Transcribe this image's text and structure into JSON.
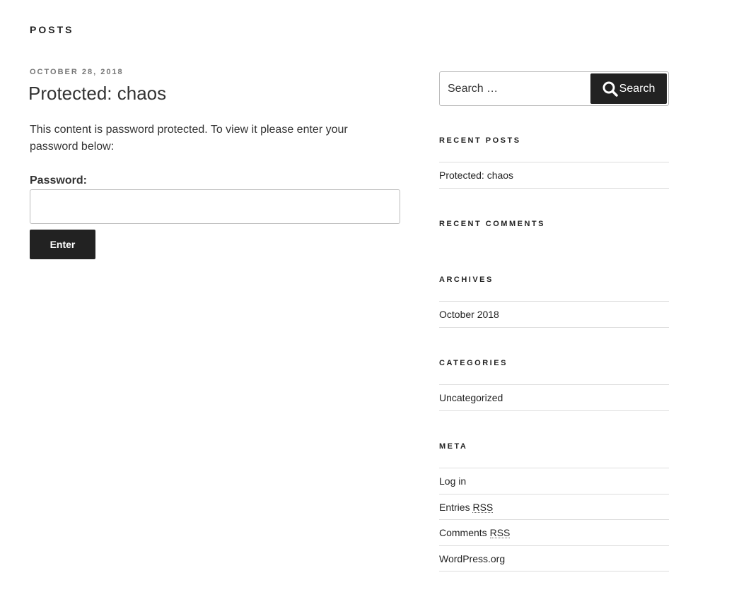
{
  "page": {
    "heading": "POSTS"
  },
  "post": {
    "date": "OCTOBER 28, 2018",
    "title": "Protected: chaos",
    "content": "This content is password protected. To view it please enter your password below:",
    "password_label": "Password:",
    "password_value": "",
    "enter_label": "Enter"
  },
  "sidebar": {
    "search": {
      "placeholder": "Search …",
      "button_label": "Search",
      "icon": "search-icon"
    },
    "recent_posts": {
      "title": "RECENT POSTS",
      "items": [
        "Protected: chaos"
      ]
    },
    "recent_comments": {
      "title": "RECENT COMMENTS"
    },
    "archives": {
      "title": "ARCHIVES",
      "items": [
        "October 2018"
      ]
    },
    "categories": {
      "title": "CATEGORIES",
      "items": [
        "Uncategorized"
      ]
    },
    "meta": {
      "title": "META",
      "login": "Log in",
      "entries_prefix": "Entries",
      "comments_prefix": "Comments",
      "rss": "RSS",
      "wordpress": "WordPress.org"
    }
  },
  "colors": {
    "button_bg": "#222222",
    "text": "#333333",
    "date_gray": "#767676",
    "border": "#dddddd"
  }
}
